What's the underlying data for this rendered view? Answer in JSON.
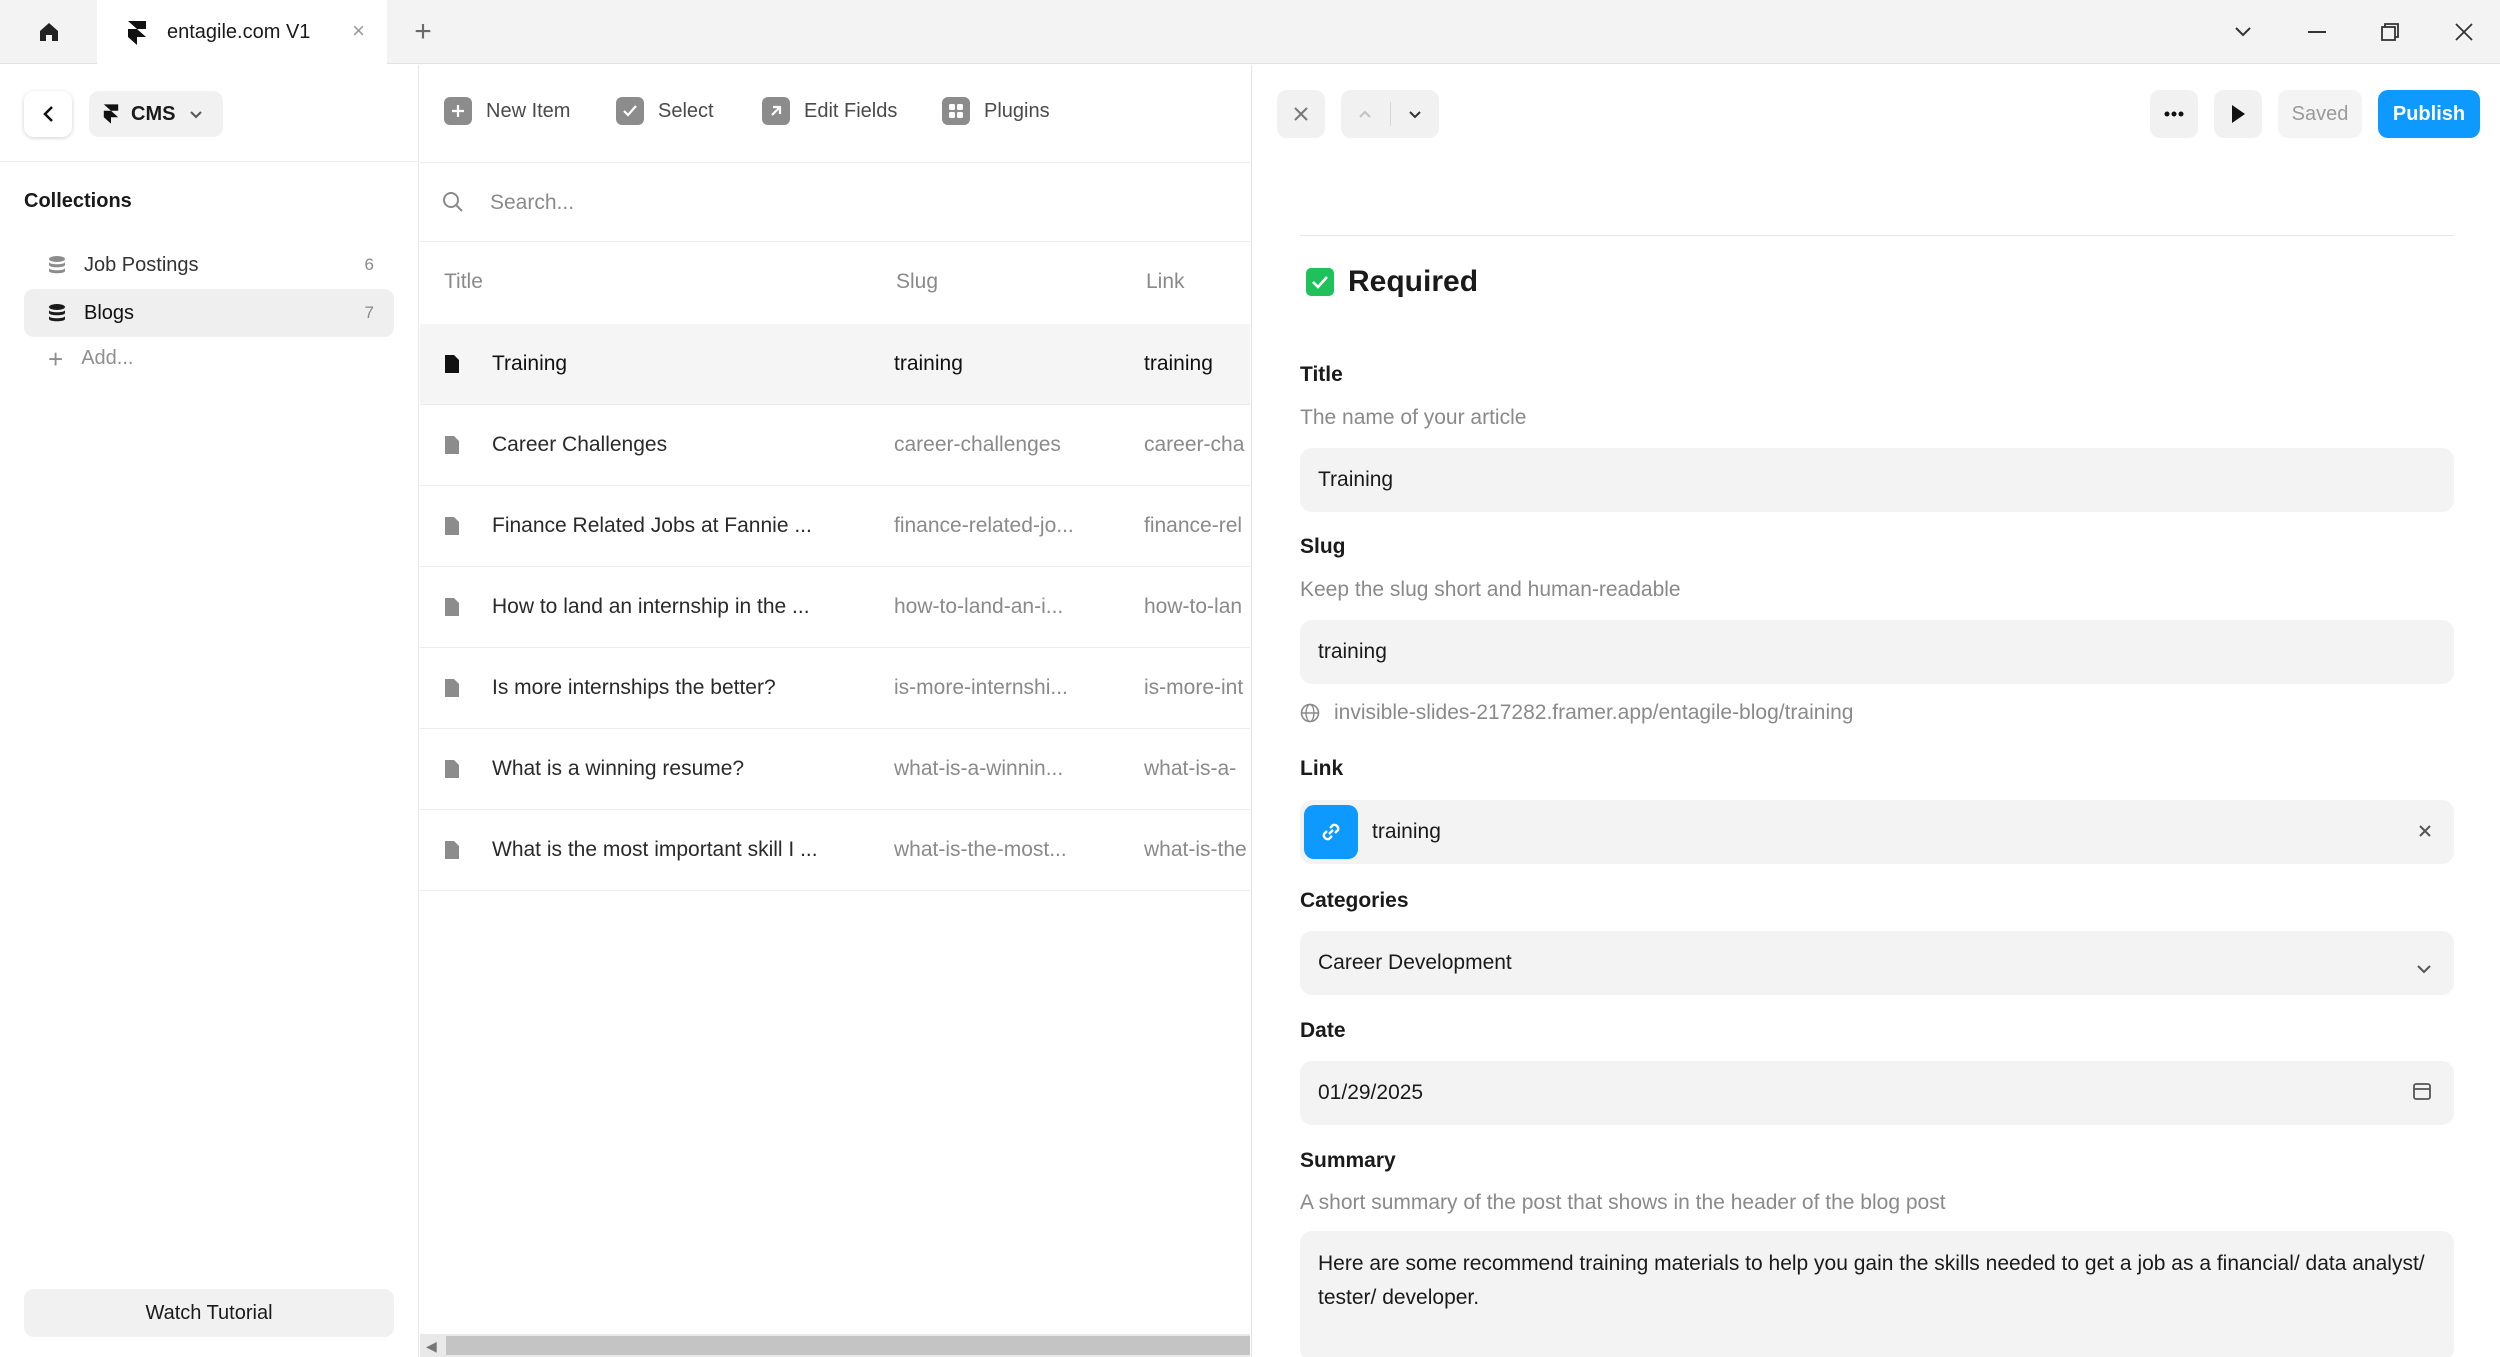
{
  "window": {
    "tab_title": "entagile.com V1",
    "tab_close": "×",
    "new_tab": "+"
  },
  "sidebar": {
    "cms_label": "CMS",
    "collections_title": "Collections",
    "collections": [
      {
        "label": "Job Postings",
        "count": "6"
      },
      {
        "label": "Blogs",
        "count": "7"
      }
    ],
    "add_label": "Add...",
    "tutorial_label": "Watch Tutorial"
  },
  "toolbar": {
    "new_item": "New Item",
    "select": "Select",
    "edit_fields": "Edit Fields",
    "plugins": "Plugins"
  },
  "list": {
    "search_placeholder": "Search...",
    "columns": {
      "title": "Title",
      "slug": "Slug",
      "link": "Link"
    },
    "rows": [
      {
        "title": "Training",
        "slug": "training",
        "link": "training"
      },
      {
        "title": "Career Challenges",
        "slug": "career-challenges",
        "link": "career-cha"
      },
      {
        "title": "Finance Related Jobs at Fannie ...",
        "slug": "finance-related-jo...",
        "link": "finance-rel"
      },
      {
        "title": "How to land an internship in the ...",
        "slug": "how-to-land-an-i...",
        "link": "how-to-lan"
      },
      {
        "title": "Is more internships the better?",
        "slug": "is-more-internshi...",
        "link": "is-more-int"
      },
      {
        "title": "What is a winning resume?",
        "slug": "what-is-a-winnin...",
        "link": "what-is-a-"
      },
      {
        "title": "What is the most important skill I ...",
        "slug": "what-is-the-most...",
        "link": "what-is-the"
      }
    ]
  },
  "panel": {
    "saved_label": "Saved",
    "publish_label": "Publish",
    "required_label": "Required",
    "title": {
      "label": "Title",
      "help": "The name of your article",
      "value": "Training"
    },
    "slug": {
      "label": "Slug",
      "help": "Keep the slug short and human-readable",
      "value": "training",
      "url": "invisible-slides-217282.framer.app/entagile-blog/training"
    },
    "link": {
      "label": "Link",
      "value": "training"
    },
    "categories": {
      "label": "Categories",
      "value": "Career Development"
    },
    "date": {
      "label": "Date",
      "value": "01/29/2025"
    },
    "summary": {
      "label": "Summary",
      "help": "A short summary of the post that shows in the header of the blog post",
      "value": "Here are some recommend training materials to help you gain the skills needed to get a job as a financial/ data analyst/ tester/ developer."
    }
  },
  "colors": {
    "accent": "#0d99ff",
    "required_check": "#1fc25a"
  }
}
